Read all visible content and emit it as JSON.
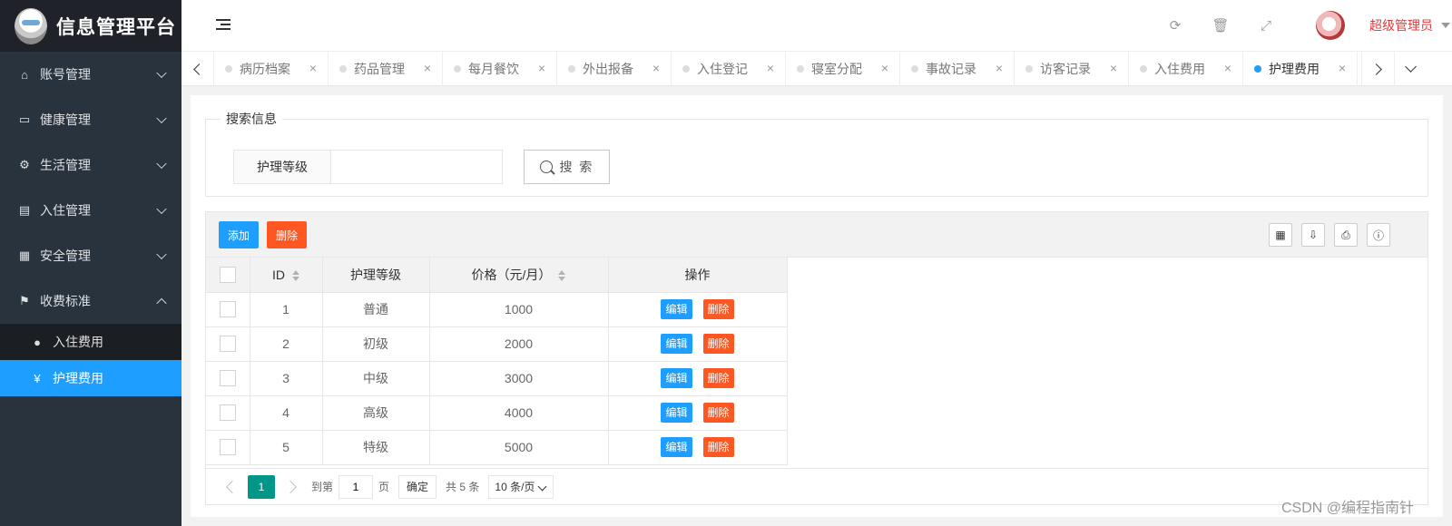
{
  "sidebar": {
    "logo_title": "信息管理平台",
    "menu": [
      {
        "label": "账号管理",
        "icon": "home-icon"
      },
      {
        "label": "健康管理",
        "icon": "window-icon"
      },
      {
        "label": "生活管理",
        "icon": "gears-icon"
      },
      {
        "label": "入住管理",
        "icon": "file-icon"
      },
      {
        "label": "安全管理",
        "icon": "calendar-icon"
      },
      {
        "label": "收费标准",
        "icon": "flag-icon"
      }
    ],
    "submenu": [
      {
        "label": "入住费用",
        "icon": "coin-icon"
      },
      {
        "label": "护理费用",
        "icon": "yen-icon",
        "active": true
      }
    ]
  },
  "header": {
    "user_name": "超级管理员"
  },
  "tabs": [
    {
      "label": "病历档案"
    },
    {
      "label": "药品管理"
    },
    {
      "label": "每月餐饮"
    },
    {
      "label": "外出报备"
    },
    {
      "label": "入住登记"
    },
    {
      "label": "寝室分配"
    },
    {
      "label": "事故记录"
    },
    {
      "label": "访客记录"
    },
    {
      "label": "入住费用"
    },
    {
      "label": "护理费用",
      "active": true
    }
  ],
  "search": {
    "legend": "搜索信息",
    "field_label": "护理等级",
    "field_value": "",
    "button_label": "搜 索"
  },
  "toolbar": {
    "add_label": "添加",
    "delete_label": "删除"
  },
  "table": {
    "headers": [
      "ID",
      "护理等级",
      "价格（元/月）",
      "操作"
    ],
    "rows": [
      {
        "id": "1",
        "level": "普通",
        "price": "1000"
      },
      {
        "id": "2",
        "level": "初级",
        "price": "2000"
      },
      {
        "id": "3",
        "level": "中级",
        "price": "3000"
      },
      {
        "id": "4",
        "level": "高级",
        "price": "4000"
      },
      {
        "id": "5",
        "level": "特级",
        "price": "5000"
      }
    ],
    "edit_label": "编辑",
    "delete_label": "删除"
  },
  "pager": {
    "current": "1",
    "goto_label": "到第",
    "goto_value": "1",
    "page_unit": "页",
    "confirm_label": "确定",
    "total_text": "共 5 条",
    "per_page": "10 条/页"
  },
  "watermark": "CSDN @编程指南针",
  "colors": {
    "sidebar_bg": "#28333e",
    "accent_blue": "#1e9fff",
    "danger_orange": "#ff5722",
    "pager_green": "#009688",
    "user_red": "#e4393c"
  }
}
